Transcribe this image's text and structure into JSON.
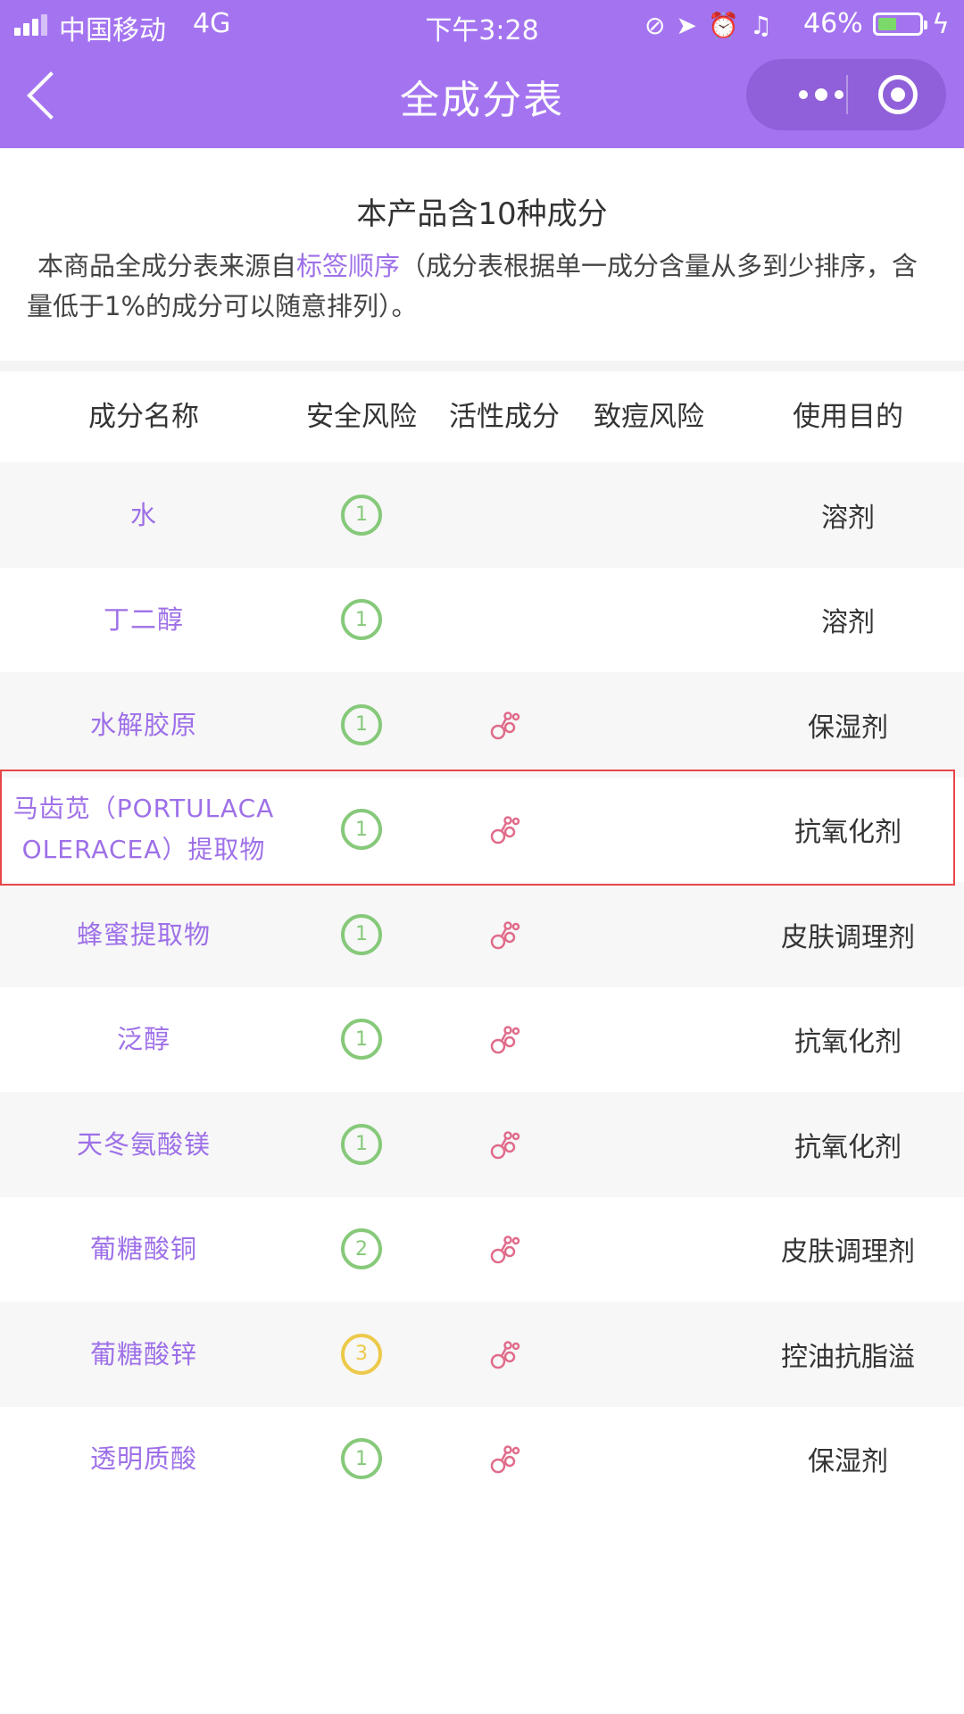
{
  "status_bar": {
    "carrier": "中国移动",
    "network": "4G",
    "time": "下午3:28",
    "battery": "46%",
    "battery_level": 0.46,
    "icons": [
      "orientation-lock-icon",
      "location-icon",
      "alarm-icon",
      "headphones-icon",
      "battery-icon",
      "charging-icon"
    ]
  },
  "nav": {
    "title": "全成分表",
    "back_icon": "back-chevron-icon",
    "more_icon": "more-dots-icon",
    "close_icon": "miniprogram-close-icon"
  },
  "intro": {
    "summary": "本产品含10种成分",
    "desc_prefix": "本商品全成分表来源自",
    "desc_link": "标签顺序",
    "desc_suffix": "（成分表根据单一成分含量从多到少排序，含量低于1%的成分可以随意排列）。"
  },
  "table": {
    "headers": [
      "成分名称",
      "安全风险",
      "活性成分",
      "致痘风险",
      "使用目的"
    ],
    "rows": [
      {
        "name": "水",
        "safety": "1",
        "active": false,
        "acne": "",
        "purpose": "溶剂"
      },
      {
        "name": "丁二醇",
        "safety": "1",
        "active": false,
        "acne": "",
        "purpose": "溶剂"
      },
      {
        "name": "水解胶原",
        "safety": "1",
        "active": true,
        "acne": "",
        "purpose": "保湿剂"
      },
      {
        "name": "马齿苋（PORTULACA OLERACEA）提取物",
        "safety": "1",
        "active": true,
        "acne": "",
        "purpose": "抗氧化剂"
      },
      {
        "name": "蜂蜜提取物",
        "safety": "1",
        "active": true,
        "acne": "",
        "purpose": "皮肤调理剂"
      },
      {
        "name": "泛醇",
        "safety": "1",
        "active": true,
        "acne": "",
        "purpose": "抗氧化剂"
      },
      {
        "name": "天冬氨酸镁",
        "safety": "1",
        "active": true,
        "acne": "",
        "purpose": "抗氧化剂"
      },
      {
        "name": "葡糖酸铜",
        "safety": "2",
        "active": true,
        "acne": "",
        "purpose": "皮肤调理剂"
      },
      {
        "name": "葡糖酸锌",
        "safety": "3",
        "active": true,
        "acne": "",
        "purpose": "控油抗脂溢"
      },
      {
        "name": "透明质酸",
        "safety": "1",
        "active": true,
        "acne": "",
        "purpose": "保湿剂"
      }
    ]
  },
  "colors": {
    "nav_bg": "#a474f0",
    "link": "#9e70e8",
    "safety_green": "#86c97a",
    "safety_yellow": "#ecc94b",
    "active_icon": "#e06b8a",
    "highlight_border": "#e8474a"
  }
}
